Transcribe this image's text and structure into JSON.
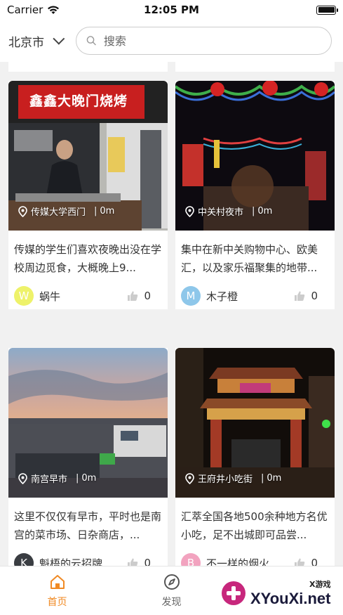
{
  "status_bar": {
    "carrier": "Carrier",
    "time": "12:05 PM"
  },
  "header": {
    "city": "北京市",
    "search_placeholder": "搜索"
  },
  "feed": [
    {
      "location": "传媒大学西门",
      "distance": "0m",
      "description": "传媒的学生们喜欢夜晚出没在学校周边觅食，大概晚上9...",
      "user": {
        "initial": "W",
        "name": "蜗牛",
        "avatar_color": "#eef26a"
      },
      "likes": "0",
      "sign_text": "鑫鑫大晚门烧烤"
    },
    {
      "location": "中关村夜市",
      "distance": "0m",
      "description": "集中在新中关购物中心、欧美汇，以及家乐福聚集的地带...",
      "user": {
        "initial": "M",
        "name": "木子橙",
        "avatar_color": "#8ec7ea"
      },
      "likes": "0"
    },
    {
      "location": "南宫早市",
      "distance": "0m",
      "description": "这里不仅仅有早市，平时也是南宫的菜市场、日杂商店，...",
      "user": {
        "initial": "K",
        "name": "魁梧的云招牌",
        "avatar_color": "#3a3d42"
      },
      "likes": "0"
    },
    {
      "location": "王府井小吃街",
      "distance": "0m",
      "description": "汇萃全国各地500余种地方名优小吃，足不出城即可品尝...",
      "user": {
        "initial": "B",
        "name": "不一样的烟火",
        "avatar_color": "#f2a3bf"
      },
      "likes": "0"
    }
  ],
  "tabs": [
    {
      "label": "首页",
      "icon": "home-icon",
      "active": true
    },
    {
      "label": "发现",
      "icon": "compass-icon",
      "active": false
    }
  ],
  "watermark": {
    "small": "X游戏",
    "big": "XYouXi.net"
  },
  "colors": {
    "accent": "#f08a24"
  }
}
